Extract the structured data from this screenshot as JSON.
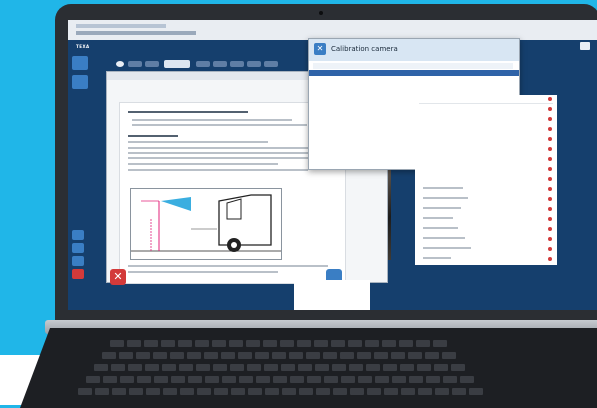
{
  "calibration_dialog": {
    "title": "Calibration camera",
    "close_icon": "close-icon"
  },
  "icons": {
    "screen_close": "close-icon",
    "app_close": "close-icon"
  },
  "colors": {
    "background": "#20b6e8",
    "screen": "#153f6d",
    "accent_blue": "#3a7ec4",
    "close_red": "#d33a3a"
  }
}
